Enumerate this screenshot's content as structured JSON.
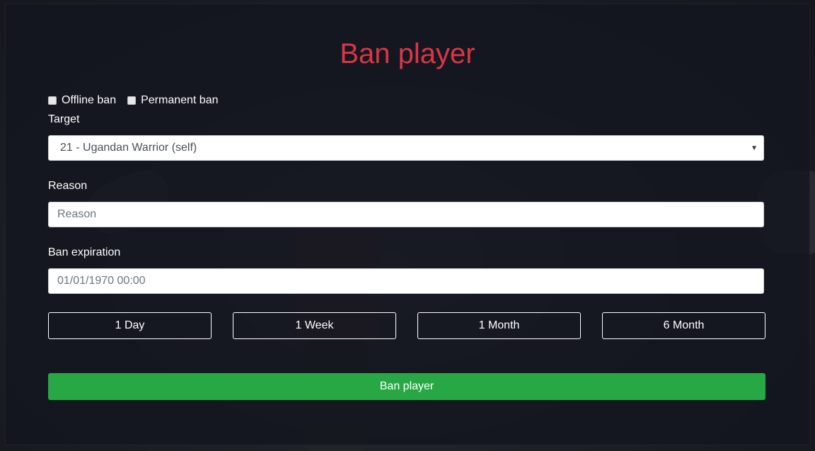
{
  "dialog": {
    "title": "Ban player"
  },
  "options": {
    "offline_ban": "Offline ban",
    "permanent_ban": "Permanent ban"
  },
  "target": {
    "label": "Target",
    "selected": "21 - Ugandan Warrior (self)"
  },
  "reason": {
    "label": "Reason",
    "placeholder": "Reason",
    "value": ""
  },
  "expiration": {
    "label": "Ban expiration",
    "value": "01/01/1970 00:00"
  },
  "durations": [
    "1 Day",
    "1 Week",
    "1 Month",
    "6 Month"
  ],
  "submit_label": "Ban player",
  "colors": {
    "title": "#dc3545",
    "submit": "#28a745"
  }
}
